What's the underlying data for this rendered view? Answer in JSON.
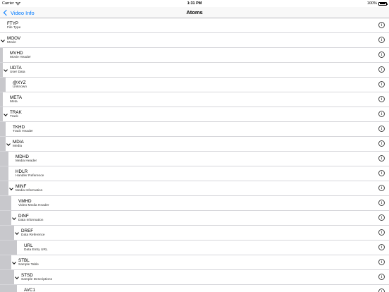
{
  "status_bar": {
    "carrier": "Carrier",
    "time": "1:31 PM",
    "battery": "100%"
  },
  "nav": {
    "back_label": "Video Info",
    "title": "Atoms"
  },
  "info_glyph": "i",
  "atoms": [
    {
      "name": "FTYP",
      "desc": "File Type",
      "depth": 0,
      "expanded": false
    },
    {
      "name": "MOOV",
      "desc": "Movie",
      "depth": 0,
      "expanded": true
    },
    {
      "name": "MVHD",
      "desc": "Movie Header",
      "depth": 1,
      "expanded": false
    },
    {
      "name": "UDTA",
      "desc": "User Data",
      "depth": 1,
      "expanded": true
    },
    {
      "name": "@XYZ",
      "desc": "Unknown",
      "depth": 2,
      "expanded": false
    },
    {
      "name": "META",
      "desc": "Meta",
      "depth": 1,
      "expanded": false
    },
    {
      "name": "TRAK",
      "desc": "Track",
      "depth": 1,
      "expanded": true
    },
    {
      "name": "TKHD",
      "desc": "Track Header",
      "depth": 2,
      "expanded": false
    },
    {
      "name": "MDIA",
      "desc": "Media",
      "depth": 2,
      "expanded": true
    },
    {
      "name": "MDHD",
      "desc": "Media Header",
      "depth": 3,
      "expanded": false
    },
    {
      "name": "HDLR",
      "desc": "Handler Reference",
      "depth": 3,
      "expanded": false
    },
    {
      "name": "MINF",
      "desc": "Media Information",
      "depth": 3,
      "expanded": true
    },
    {
      "name": "VMHD",
      "desc": "Video Media Header",
      "depth": 4,
      "expanded": false
    },
    {
      "name": "DINF",
      "desc": "Data Information",
      "depth": 4,
      "expanded": true
    },
    {
      "name": "DREF",
      "desc": "Data Reference",
      "depth": 5,
      "expanded": true
    },
    {
      "name": "URL",
      "desc": "Data Entry URL",
      "depth": 6,
      "expanded": false
    },
    {
      "name": "STBL",
      "desc": "Sample Table",
      "depth": 4,
      "expanded": true
    },
    {
      "name": "STSD",
      "desc": "Sample Descriptions",
      "depth": 5,
      "expanded": true
    },
    {
      "name": "AVC1",
      "desc": "",
      "depth": 6,
      "expanded": false
    }
  ]
}
